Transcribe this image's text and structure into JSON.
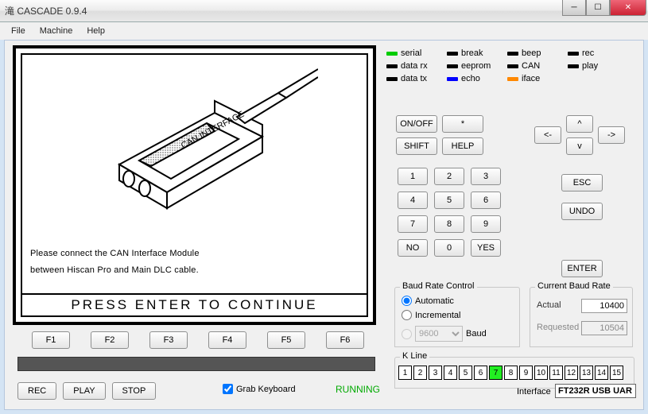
{
  "window": {
    "title": "滝  CASCADE 0.9.4"
  },
  "menu": {
    "file": "File",
    "machine": "Machine",
    "help": "Help"
  },
  "display": {
    "device_label": "CAN INTERFACE",
    "message_line1": "Please connect the CAN Interface Module",
    "message_line2": "between Hiscan Pro and Main DLC cable.",
    "prompt": "PRESS  ENTER  TO  CONTINUE"
  },
  "fkeys": {
    "f1": "F1",
    "f2": "F2",
    "f3": "F3",
    "f4": "F4",
    "f5": "F5",
    "f6": "F6"
  },
  "bottom": {
    "rec": "REC",
    "play": "PLAY",
    "stop": "STOP",
    "grab": "Grab Keyboard",
    "grab_checked": true,
    "status": "RUNNING"
  },
  "leds": {
    "serial": {
      "label": "serial",
      "color": "#0c0"
    },
    "break": {
      "label": "break",
      "color": "#000"
    },
    "beep": {
      "label": "beep",
      "color": "#000"
    },
    "rec": {
      "label": "rec",
      "color": "#000"
    },
    "datarx": {
      "label": "data rx",
      "color": "#000"
    },
    "eeprom": {
      "label": "eeprom",
      "color": "#000"
    },
    "can": {
      "label": "CAN",
      "color": "#000"
    },
    "play": {
      "label": "play",
      "color": "#000"
    },
    "datatx": {
      "label": "data tx",
      "color": "#000"
    },
    "echo": {
      "label": "echo",
      "color": "#00f"
    },
    "iface": {
      "label": "iface",
      "color": "#f80"
    }
  },
  "ctrl": {
    "onoff": "ON/OFF",
    "star": "*",
    "shift": "SHIFT",
    "help": "HELP"
  },
  "arrows": {
    "left": "<-",
    "up": "^",
    "down": "v",
    "right": "->"
  },
  "keypad": {
    "k1": "1",
    "k2": "2",
    "k3": "3",
    "k4": "4",
    "k5": "5",
    "k6": "6",
    "k7": "7",
    "k8": "8",
    "k9": "9",
    "no": "NO",
    "k0": "0",
    "yes": "YES"
  },
  "side": {
    "esc": "ESC",
    "undo": "UNDO",
    "enter": "ENTER"
  },
  "baud": {
    "legend": "Baud Rate Control",
    "auto": "Automatic",
    "inc": "Incremental",
    "unit": "Baud",
    "select": "9600",
    "selected": "auto"
  },
  "current": {
    "legend": "Current Baud Rate",
    "actual_label": "Actual",
    "actual": "10400",
    "requested_label": "Requested",
    "requested": "10504"
  },
  "kline": {
    "legend": "K Line",
    "cells": [
      "1",
      "2",
      "3",
      "4",
      "5",
      "6",
      "7",
      "8",
      "9",
      "10",
      "11",
      "12",
      "13",
      "14",
      "15"
    ],
    "active_index": 6
  },
  "interface": {
    "label": "Interface",
    "value": "FT232R USB UAR"
  }
}
